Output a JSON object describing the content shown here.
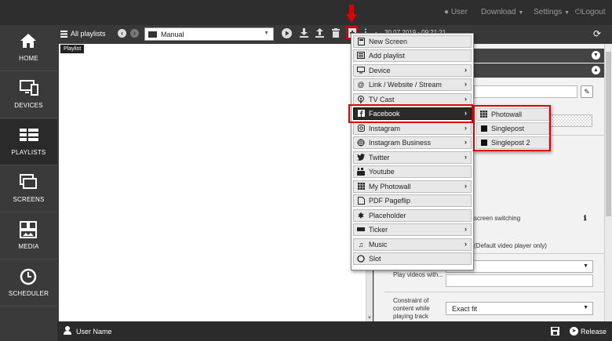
{
  "topbar": {
    "user": "User",
    "download": "Download",
    "settings": "Settings",
    "logout": "Logout"
  },
  "sidebar": {
    "items": [
      {
        "label": "HOME",
        "icon": "home-icon"
      },
      {
        "label": "DEVICES",
        "icon": "devices-icon"
      },
      {
        "label": "PLAYLISTS",
        "icon": "playlists-icon",
        "active": true
      },
      {
        "label": "SCREENS",
        "icon": "screens-icon"
      },
      {
        "label": "MEDIA",
        "icon": "media-icon"
      },
      {
        "label": "SCHEDULER",
        "icon": "scheduler-icon"
      }
    ]
  },
  "toolbar": {
    "title": "All playlists",
    "selected_playlist": "Manual",
    "datetime": "30.07.2019 - 09:21:21"
  },
  "canvas": {
    "tag": "Playlist"
  },
  "add_menu": {
    "items": [
      {
        "label": "New Screen",
        "icon": "new-screen-icon",
        "submenu": false
      },
      {
        "label": "Add playlist",
        "icon": "playlist-icon",
        "submenu": false
      },
      {
        "label": "Device",
        "icon": "device-icon",
        "submenu": true
      },
      {
        "label": "Link / Website / Stream",
        "icon": "at-icon",
        "submenu": true
      },
      {
        "label": "TV Cast",
        "icon": "tv-cast-icon",
        "submenu": true
      },
      {
        "label": "Facebook",
        "icon": "facebook-icon",
        "submenu": true,
        "highlighted": true
      },
      {
        "label": "Instagram",
        "icon": "instagram-icon",
        "submenu": true
      },
      {
        "label": "Instagram Business",
        "icon": "instagram-business-icon",
        "submenu": true
      },
      {
        "label": "Twitter",
        "icon": "twitter-icon",
        "submenu": true
      },
      {
        "label": "Youtube",
        "icon": "youtube-icon",
        "submenu": false
      },
      {
        "label": "My Photowall",
        "icon": "photowall-icon",
        "submenu": true
      },
      {
        "label": "PDF Pageflip",
        "icon": "pdf-icon",
        "submenu": false
      },
      {
        "label": "Placeholder",
        "icon": "placeholder-icon",
        "submenu": false
      },
      {
        "label": "Ticker",
        "icon": "ticker-icon",
        "submenu": true
      },
      {
        "label": "Music",
        "icon": "music-icon",
        "submenu": true
      },
      {
        "label": "Slot",
        "icon": "slot-icon",
        "submenu": false
      }
    ]
  },
  "facebook_submenu": {
    "items": [
      {
        "label": "Photowall",
        "icon": "grid-icon"
      },
      {
        "label": "Singlepost",
        "icon": "square-icon"
      },
      {
        "label": "Singlepost 2",
        "icon": "square-icon"
      }
    ]
  },
  "panel": {
    "screen_switching": "screen switching",
    "default_video": "(Default video player only)",
    "play_videos_label": "Play videos with...",
    "constraint_label_1": "Constraint of",
    "constraint_label_2": "content while",
    "constraint_label_3": "playing track",
    "constraint_value": "Exact fit"
  },
  "bottombar": {
    "user_name": "User Name",
    "release": "Release"
  },
  "colors": {
    "highlight_red": "#e00000",
    "dark_bar": "#2e2e2e",
    "menu_item_bg": "#e8e8e8"
  }
}
